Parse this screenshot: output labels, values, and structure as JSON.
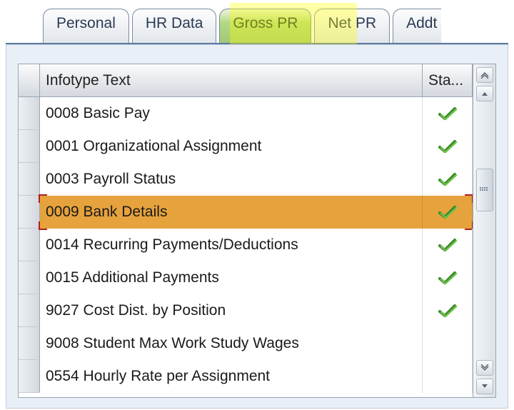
{
  "tabs": [
    {
      "label": "Personal",
      "active": false
    },
    {
      "label": "HR Data",
      "active": false
    },
    {
      "label": "Gross PR",
      "active": true
    },
    {
      "label": "Net PR",
      "active": false
    },
    {
      "label": "Addt",
      "active": false,
      "partial": true
    }
  ],
  "columns": {
    "text_header": "Infotype Text",
    "status_header": "Sta..."
  },
  "rows": [
    {
      "text": "0008 Basic Pay",
      "status": true,
      "selected": false
    },
    {
      "text": "0001 Organizational Assignment",
      "status": true,
      "selected": false
    },
    {
      "text": "0003 Payroll Status",
      "status": true,
      "selected": false
    },
    {
      "text": "0009 Bank Details",
      "status": true,
      "selected": true
    },
    {
      "text": "0014 Recurring Payments/Deductions",
      "status": true,
      "selected": false
    },
    {
      "text": "0015 Additional Payments",
      "status": true,
      "selected": false
    },
    {
      "text": "9027 Cost Dist. by Position",
      "status": true,
      "selected": false
    },
    {
      "text": "9008 Student Max Work Study Wages",
      "status": false,
      "selected": false
    },
    {
      "text": "0554 Hourly Rate per Assignment",
      "status": false,
      "selected": false
    }
  ]
}
